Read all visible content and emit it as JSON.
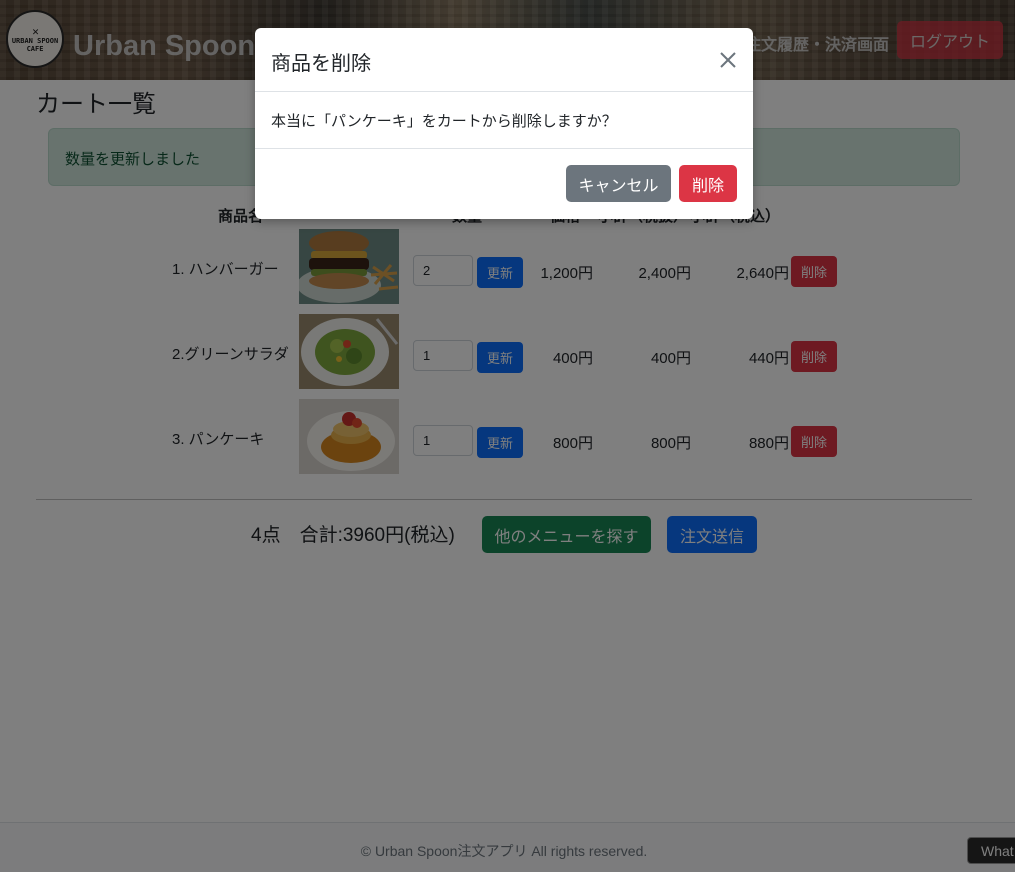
{
  "header": {
    "logo_text": "URBAN SPOON CAFE",
    "app_title": "Urban Spoon注文アプリ",
    "nav_link": "注文履歴・決済画面",
    "logout_label": "ログアウト"
  },
  "page": {
    "title": "カート一覧",
    "alert": "数量を更新しました"
  },
  "table": {
    "headers": [
      "商品名",
      "数量",
      "価格",
      "小計（税抜）",
      "小計（税込）"
    ],
    "rows": [
      {
        "name": "1. ハンバーガー",
        "qty": "2",
        "update_label": "更新",
        "price": "1,200円",
        "subtotal": "2,400円",
        "total": "2,640円",
        "delete_label": "削除"
      },
      {
        "name": "2.グリーンサラダ",
        "qty": "1",
        "update_label": "更新",
        "price": "400円",
        "subtotal": "400円",
        "total": "440円",
        "delete_label": "削除"
      },
      {
        "name": "3. パンケーキ",
        "qty": "1",
        "update_label": "更新",
        "price": "800円",
        "subtotal": "800円",
        "total": "880円",
        "delete_label": "削除"
      }
    ]
  },
  "summary": {
    "text": "4点　合計:3960円(税込)",
    "other_menu_label": "他のメニューを探す",
    "order_label": "注文送信"
  },
  "footer": {
    "copyright": "© Urban Spoon注文アプリ All rights reserved."
  },
  "chat_widget": {
    "label": "What"
  },
  "modal": {
    "title": "商品を削除",
    "body": "本当に「パンケーキ」をカートから削除しますか？",
    "cancel_label": "キャンセル",
    "confirm_label": "削除"
  },
  "colors": {
    "primary": "#0d6efd",
    "danger": "#dc3545",
    "success": "#198754",
    "secondary": "#6c757d",
    "alert_bg": "#d1e7dd"
  },
  "icons": {
    "close": "close-icon"
  }
}
